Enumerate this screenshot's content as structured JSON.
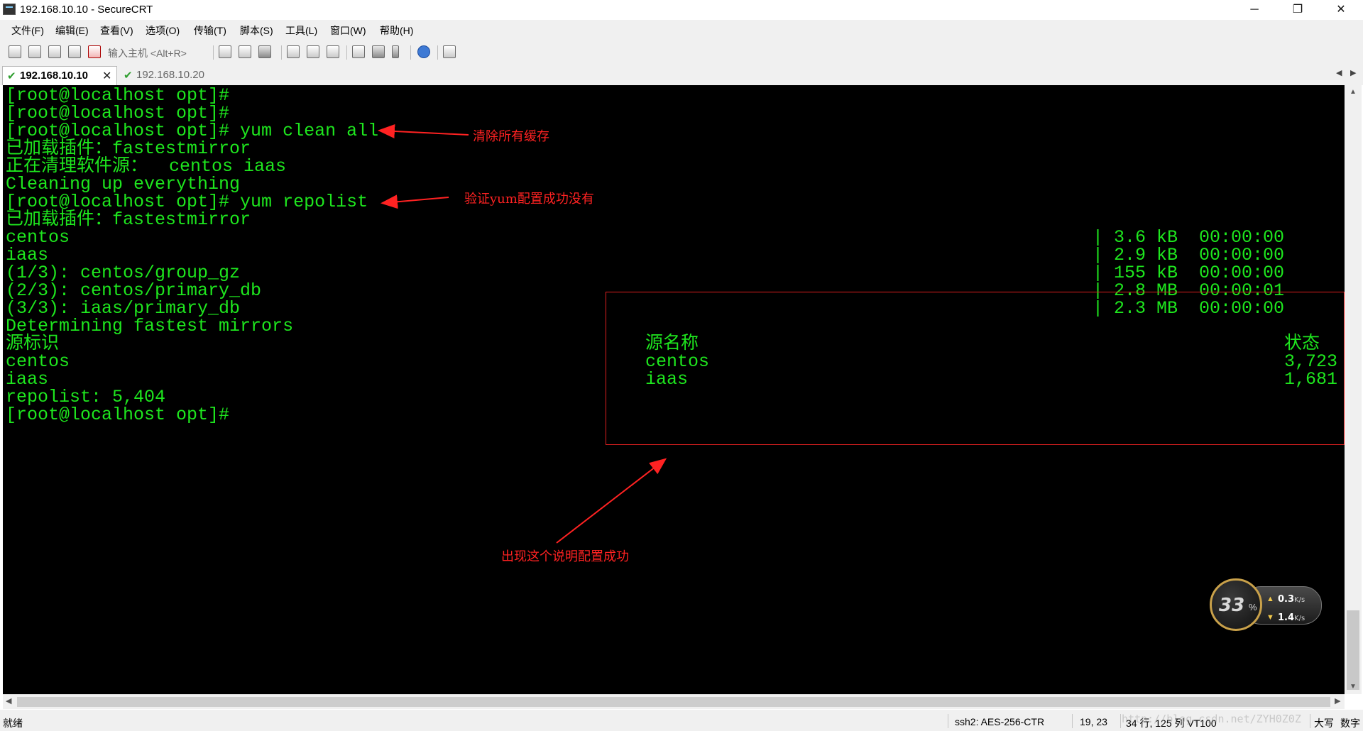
{
  "window": {
    "title": "192.168.10.10 - SecureCRT",
    "minimize": "─",
    "maximize": "❐",
    "close": "✕"
  },
  "menu": [
    "文件(F)",
    "编辑(E)",
    "查看(V)",
    "选项(O)",
    "传输(T)",
    "脚本(S)",
    "工具(L)",
    "窗口(W)",
    "帮助(H)"
  ],
  "toolbar": {
    "quick_connect_placeholder": "输入主机 <Alt+R>",
    "icons": [
      "connect-icon",
      "quick-connect-icon",
      "connect-tab-icon",
      "reconnect-icon",
      "disconnect-icon",
      "copy-icon",
      "paste-icon",
      "find-icon",
      "print-icon",
      "print-selection-icon",
      "print-setup-icon",
      "session-options-icon",
      "global-options-icon",
      "keymap-icon",
      "help-icon",
      "sftp-icon"
    ]
  },
  "tabs": [
    {
      "label": "192.168.10.10",
      "active": true,
      "close": "✕"
    },
    {
      "label": "192.168.10.20",
      "active": false
    }
  ],
  "terminal": {
    "lines": [
      "[root@localhost opt]#",
      "[root@localhost opt]#",
      "[root@localhost opt]# yum clean all",
      "已加载插件：fastestmirror",
      "正在清理软件源：  centos iaas",
      "Cleaning up everything",
      "[root@localhost opt]# yum repolist",
      "已加载插件：fastestmirror",
      "centos",
      "iaas",
      "(1/3): centos/group_gz",
      "(2/3): centos/primary_db",
      "(3/3): iaas/primary_db",
      "Determining fastest mirrors",
      "源标识",
      "centos",
      "iaas",
      "repolist: 5,404",
      "[root@localhost opt]#"
    ],
    "downloads": [
      "| 3.6 kB  00:00:00",
      "| 2.9 kB  00:00:00",
      "| 155 kB  00:00:00",
      "| 2.8 MB  00:00:01",
      "| 2.3 MB  00:00:00"
    ],
    "repo_table": {
      "name_header": "源名称",
      "status_header": "状态",
      "rows": [
        {
          "name": "centos",
          "status": "3,723"
        },
        {
          "name": "iaas",
          "status": "1,681"
        }
      ]
    }
  },
  "annotations": {
    "clean": "清除所有缓存",
    "verify": "验证yum配置成功没有",
    "success": "出现这个说明配置成功",
    "color": "#ff2222"
  },
  "speed_widget": {
    "percent": "33",
    "percent_sign": "%",
    "up_value": "0.3",
    "down_value": "1.4",
    "unit": "K/s",
    "up_arrow": "▲",
    "down_arrow": "▼"
  },
  "statusbar": {
    "ready": "就绪",
    "cipher": "ssh2: AES-256-CTR",
    "cursor": "19, 23",
    "size": "34 行, 125 列 VT100",
    "caps": "大写",
    "num": "数字"
  },
  "watermark": "http://blog.csdn.net/ZYH0Z0Z",
  "colors": {
    "terminal_bg": "#000000",
    "terminal_fg": "#1ee61e"
  }
}
